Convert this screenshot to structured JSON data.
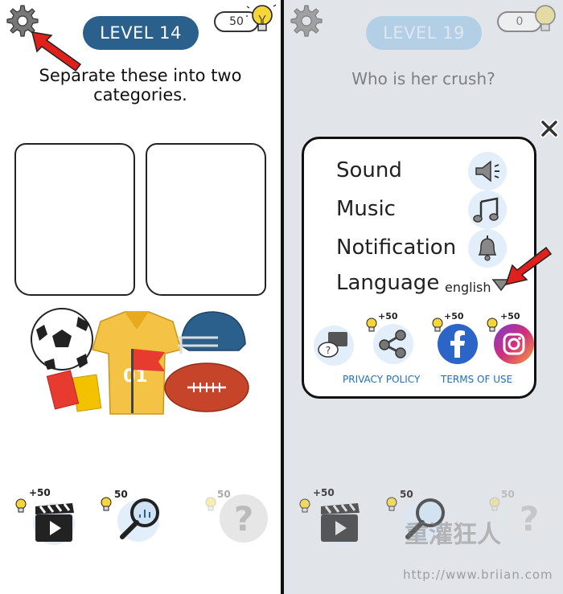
{
  "left": {
    "level_label": "LEVEL 14",
    "coins": "50",
    "question": "Separate these into two categories.",
    "bottom": {
      "video_cost": "+50",
      "hint_cost": "50",
      "skip_cost": "50"
    }
  },
  "right": {
    "level_label": "LEVEL 19",
    "coins": "0",
    "question": "Who is her crush?",
    "settings": {
      "sound": "Sound",
      "music": "Music",
      "notification": "Notification",
      "language": "Language",
      "language_value": "english"
    },
    "social": {
      "share_cost": "+50",
      "facebook_cost": "+50",
      "instagram_cost": "+50"
    },
    "privacy": "PRIVACY POLICY",
    "terms": "TERMS OF USE",
    "bottom": {
      "video_cost": "+50",
      "hint_cost": "50",
      "skip_cost": "50"
    }
  },
  "watermark": {
    "text": "重灌狂人",
    "url": "http://www.briian.com"
  },
  "colors": {
    "level_pill": "#2b5f8c",
    "level_pill_faded": "#a8d0f0",
    "link": "#1e6fb8",
    "arrow": "#e0201c"
  }
}
